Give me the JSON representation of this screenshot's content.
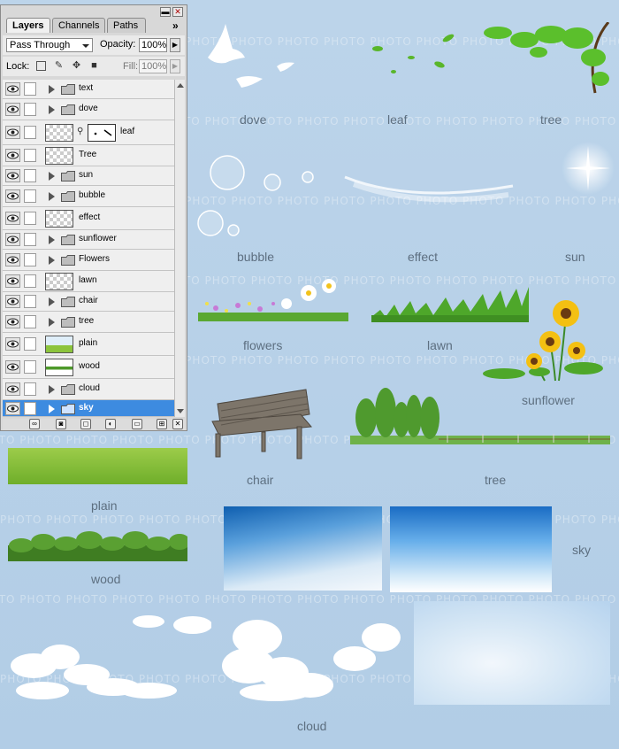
{
  "panel": {
    "tabs": [
      {
        "label": "Layers",
        "active": true
      },
      {
        "label": "Channels",
        "active": false
      },
      {
        "label": "Paths",
        "active": false
      }
    ],
    "menu_glyph": "»",
    "blend_mode": "Pass Through",
    "opacity_label": "Opacity:",
    "opacity_value": "100%",
    "lock_label": "Lock:",
    "fill_label": "Fill:",
    "fill_value": "100%",
    "layers": [
      {
        "name": "text",
        "type": "group",
        "selected": false
      },
      {
        "name": "dove",
        "type": "group",
        "selected": false
      },
      {
        "name": "leaf",
        "type": "layer-mask",
        "selected": false
      },
      {
        "name": "Tree",
        "type": "layer",
        "selected": false
      },
      {
        "name": "sun",
        "type": "group",
        "selected": false
      },
      {
        "name": "bubble",
        "type": "group",
        "selected": false
      },
      {
        "name": "effect",
        "type": "layer",
        "selected": false
      },
      {
        "name": "sunflower",
        "type": "group",
        "selected": false
      },
      {
        "name": "Flowers",
        "type": "group",
        "selected": false
      },
      {
        "name": "lawn",
        "type": "layer",
        "selected": false
      },
      {
        "name": "chair",
        "type": "group",
        "selected": false
      },
      {
        "name": "tree",
        "type": "group",
        "selected": false
      },
      {
        "name": "plain",
        "type": "layer",
        "selected": false
      },
      {
        "name": "wood",
        "type": "layer",
        "selected": false
      },
      {
        "name": "cloud",
        "type": "group",
        "selected": false
      },
      {
        "name": "sky",
        "type": "group",
        "selected": true
      }
    ]
  },
  "canvas": {
    "watermark_text": "PHOTO",
    "labels": {
      "dove": "dove",
      "leaf": "leaf",
      "tree_top": "tree",
      "bubble": "bubble",
      "effect": "effect",
      "sun": "sun",
      "flowers": "flowers",
      "lawn": "lawn",
      "sunflower": "sunflower",
      "chair": "chair",
      "tree": "tree",
      "plain": "plain",
      "sky": "sky",
      "wood": "wood",
      "cloud": "cloud"
    }
  },
  "colors": {
    "background": "#b7d0e7",
    "selection": "#3d8be0",
    "label": "#5d6f80"
  }
}
